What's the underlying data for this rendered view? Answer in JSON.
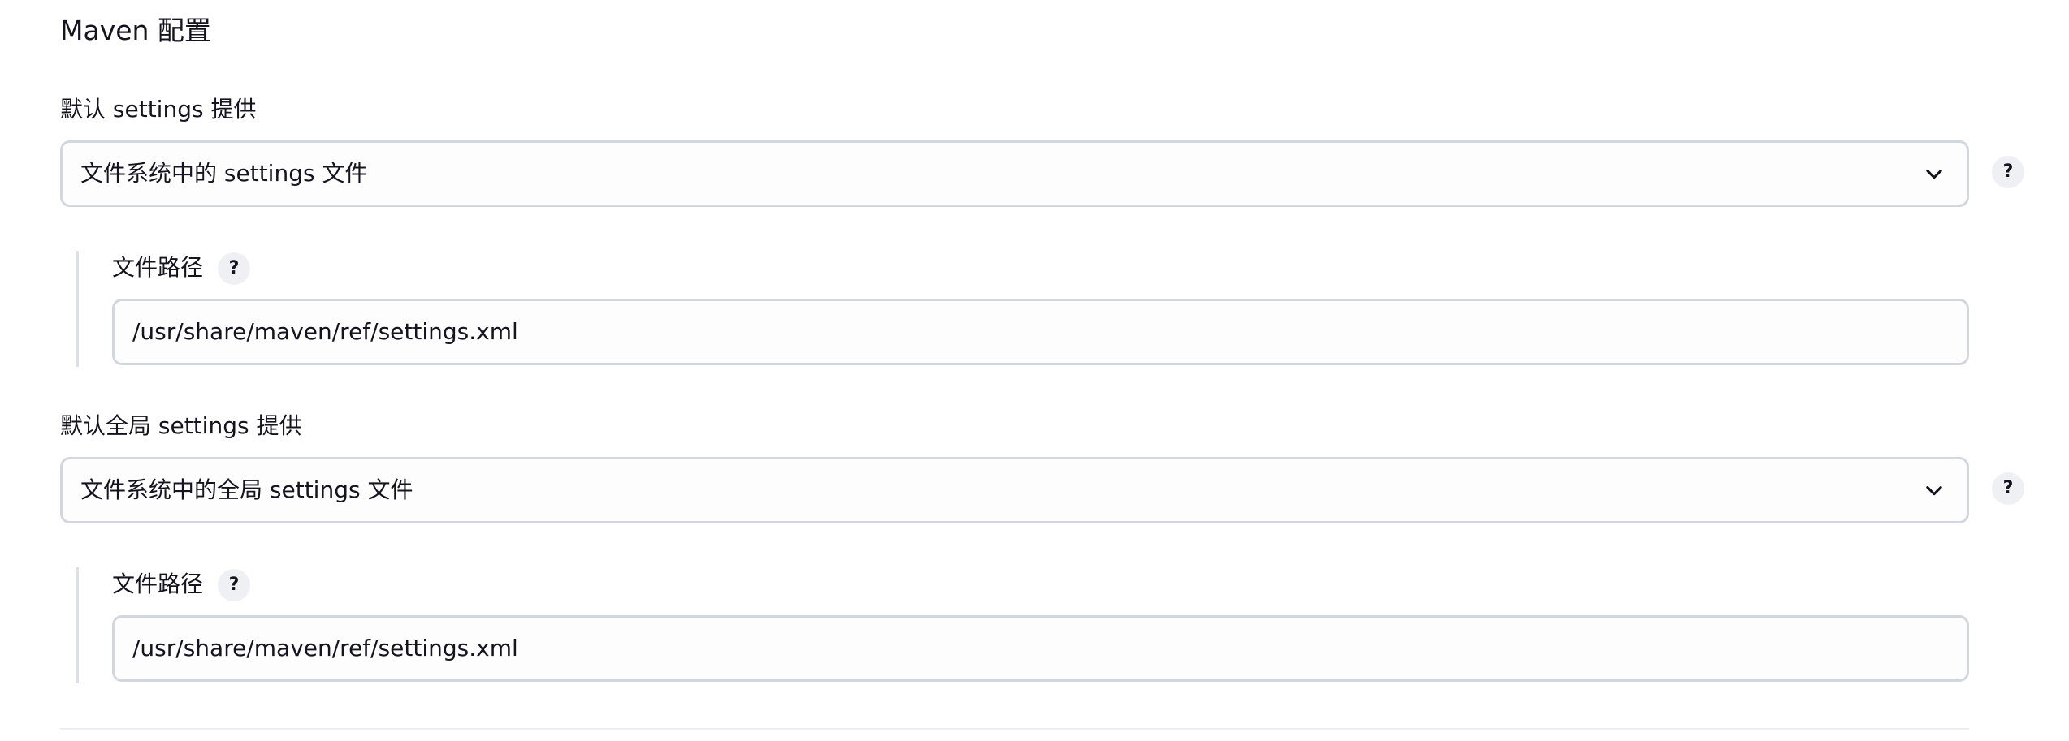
{
  "section": {
    "title": "Maven 配置"
  },
  "default_settings": {
    "label": "默认 settings 提供",
    "selected": "文件系统中的 settings 文件",
    "help": "?",
    "file_path": {
      "label": "文件路径",
      "help": "?",
      "value": "/usr/share/maven/ref/settings.xml"
    }
  },
  "global_settings": {
    "label": "默认全局 settings 提供",
    "selected": "文件系统中的全局 settings 文件",
    "help": "?",
    "file_path": {
      "label": "文件路径",
      "help": "?",
      "value": "/usr/share/maven/ref/settings.xml"
    }
  },
  "icons": {
    "dropdown": "chevron-down-icon",
    "help": "help-icon"
  },
  "colors": {
    "text": "#14141f",
    "border": "#d2d7df",
    "field_background": "#fdfdfd",
    "help_background": "#eef0f3",
    "rail": "#dde1e6"
  }
}
